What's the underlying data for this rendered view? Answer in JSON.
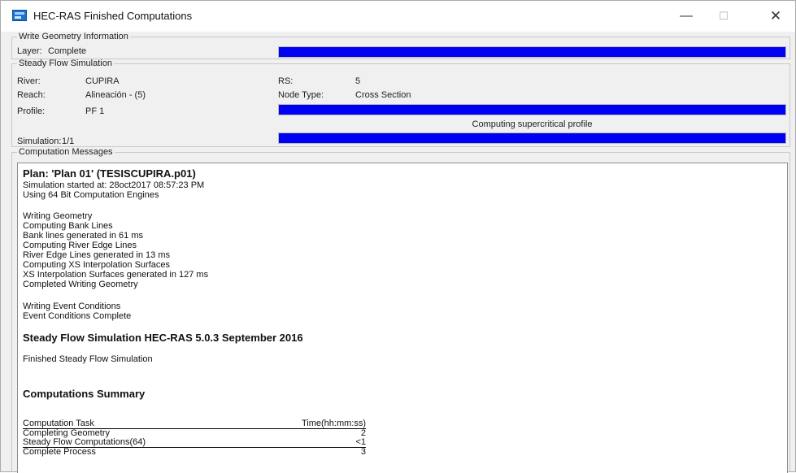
{
  "window": {
    "title": "HEC-RAS Finished Computations",
    "icons": {
      "app": "hec-ras-app-icon",
      "minimize": "minimize-icon",
      "maximize": "maximize-icon",
      "close": "close-icon"
    },
    "minimize_glyph": "—",
    "maximize_glyph": "☐",
    "close_glyph": "✕"
  },
  "write_geometry": {
    "legend": "Write Geometry Information",
    "layer_label": "Layer:",
    "layer_value": "Complete",
    "progress": 1.0
  },
  "steady_flow": {
    "legend": "Steady Flow Simulation",
    "river_label": "River:",
    "river_value": "CUPIRA",
    "reach_label": "Reach:",
    "reach_value": "Alineación - (5)",
    "profile_label": "Profile:",
    "profile_value": "PF 1",
    "rs_label": "RS:",
    "rs_value": "5",
    "node_type_label": "Node Type:",
    "node_type_value": "Cross Section",
    "simulation_label": "Simulation:",
    "simulation_value": "1/1",
    "profile_progress": 1.0,
    "status_text": "Computing supercritical profile",
    "simulation_progress": 1.0
  },
  "messages": {
    "legend": "Computation Messages",
    "plan_line": "Plan: 'Plan 01' (TESISCUPIRA.p01)",
    "started": "Simulation started at: 28oct2017 08:57:23 PM",
    "engines": "Using 64 Bit Computation Engines",
    "writing_geometry": "Writing Geometry",
    "computing_bank_lines": "Computing Bank Lines",
    "bank_lines_generated": "Bank lines generated in 61 ms",
    "computing_river_edge": "Computing River Edge Lines",
    "river_edge_generated": "River Edge Lines generated in 13 ms",
    "computing_xs": "Computing XS Interpolation Surfaces",
    "xs_generated": "XS Interpolation Surfaces generated in 127 ms",
    "completed_geometry": "Completed Writing Geometry",
    "writing_event": "Writing Event Conditions",
    "event_complete": "Event Conditions Complete",
    "steady_header": "Steady Flow Simulation HEC-RAS 5.0.3 September 2016",
    "finished_steady": "Finished Steady Flow Simulation",
    "summary_title": "Computations Summary",
    "summary_headers": {
      "task": "Computation Task",
      "time": "Time(hh:mm:ss)"
    },
    "summary_rows": [
      {
        "task": "Completing Geometry",
        "time": "2"
      },
      {
        "task": "Steady Flow Computations(64)",
        "time": "<1"
      },
      {
        "task": "Complete Process",
        "time": "3"
      }
    ]
  }
}
